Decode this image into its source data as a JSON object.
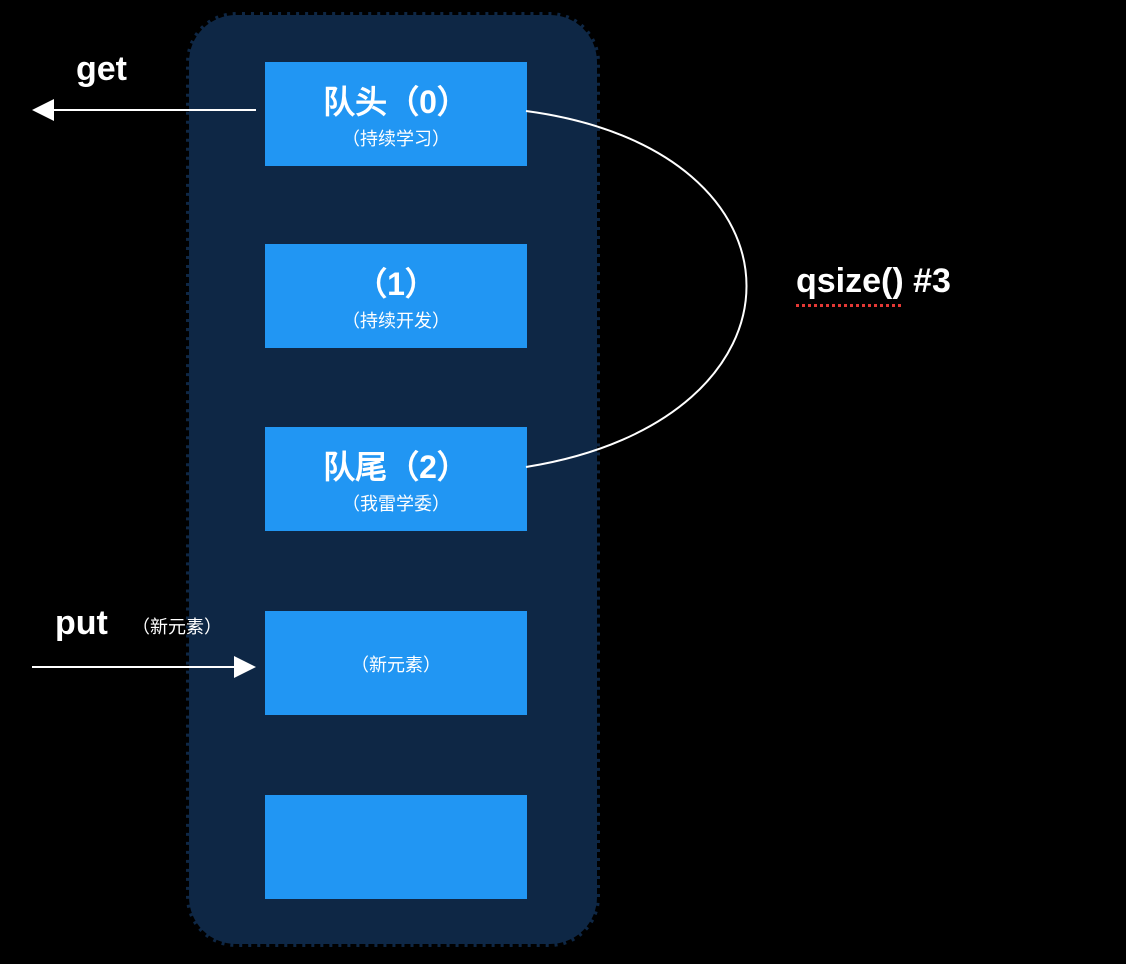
{
  "labels": {
    "get": "get",
    "put": "put",
    "put_sub": "（新元素）",
    "qsize": "qsize() #3"
  },
  "queue": {
    "boxes": [
      {
        "title": "队头（0）",
        "subtitle": "（持续学习）"
      },
      {
        "title": "（1）",
        "subtitle": "（持续开发）"
      },
      {
        "title": "队尾（2）",
        "subtitle": "（我雷学委）"
      },
      {
        "title": "",
        "subtitle": "（新元素）"
      },
      {
        "title": "",
        "subtitle": ""
      }
    ]
  }
}
